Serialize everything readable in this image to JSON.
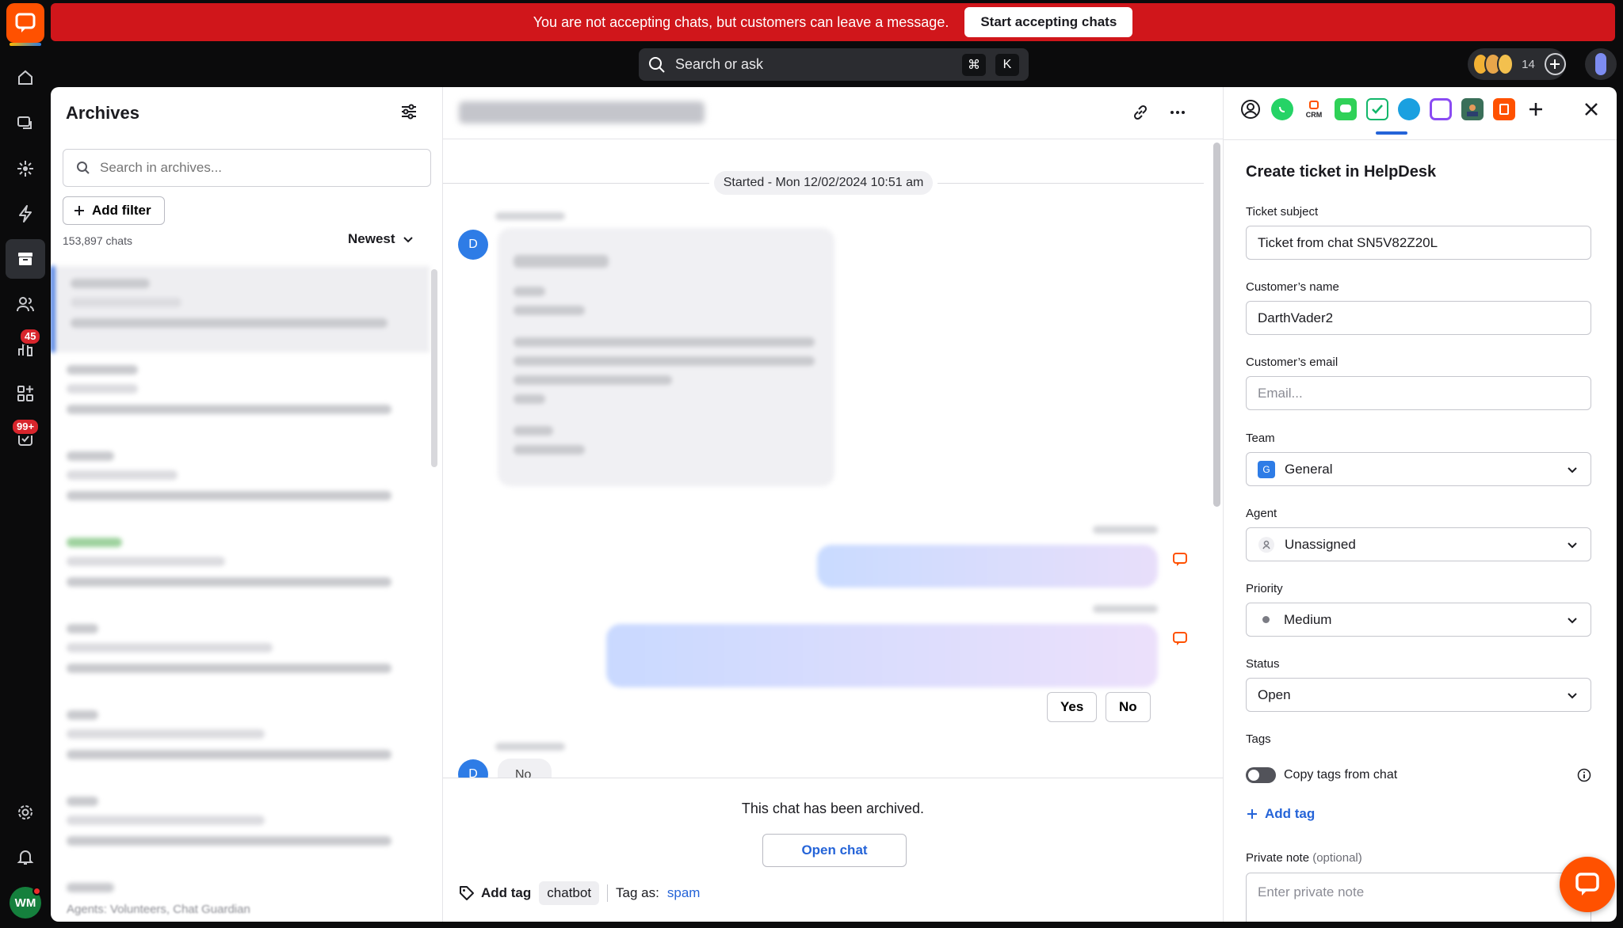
{
  "banner": {
    "message": "You are not accepting chats, but customers can leave a message.",
    "button": "Start accepting chats"
  },
  "topbar": {
    "search_placeholder": "Search or ask",
    "shortcut_cmd": "⌘",
    "shortcut_key": "K",
    "team_count": "14"
  },
  "rail": {
    "badges": {
      "reports": "45",
      "tickets": "99+"
    },
    "user_initials": "WM"
  },
  "archives": {
    "title": "Archives",
    "search_placeholder": "Search in archives...",
    "add_filter": "Add filter",
    "count": "153,897 chats",
    "sort": "Newest",
    "footer": "Agents: Volunteers, Chat Guardian"
  },
  "chat": {
    "started": "Started - Mon 12/02/2024 10:51 am",
    "avatar_initial": "D",
    "quick_replies": [
      "Yes",
      "No"
    ],
    "last_message": "No",
    "archived_message": "This chat has been archived.",
    "open_chat": "Open chat",
    "add_tag": "Add tag",
    "tag_chip": "chatbot",
    "tag_as_label": "Tag as:",
    "tag_as_value": "spam"
  },
  "ticket": {
    "title": "Create ticket in HelpDesk",
    "subject_label": "Ticket subject",
    "subject_value": "Ticket from chat SN5V82Z20L",
    "name_label": "Customer’s name",
    "name_value": "DarthVader2",
    "email_label": "Customer’s email",
    "email_placeholder": "Email...",
    "team_label": "Team",
    "team_badge": "G",
    "team_value": "General",
    "agent_label": "Agent",
    "agent_value": "Unassigned",
    "priority_label": "Priority",
    "priority_value": "Medium",
    "status_label": "Status",
    "status_value": "Open",
    "tags_label": "Tags",
    "copy_tags": "Copy tags from chat",
    "add_tag": "Add tag",
    "note_label": "Private note",
    "note_optional": "(optional)",
    "note_placeholder": "Enter private note"
  },
  "apps": {
    "crm_label": "CRM"
  },
  "colors": {
    "brand": "#ff5100",
    "banner": "#d0161b",
    "link": "#2564d8"
  }
}
